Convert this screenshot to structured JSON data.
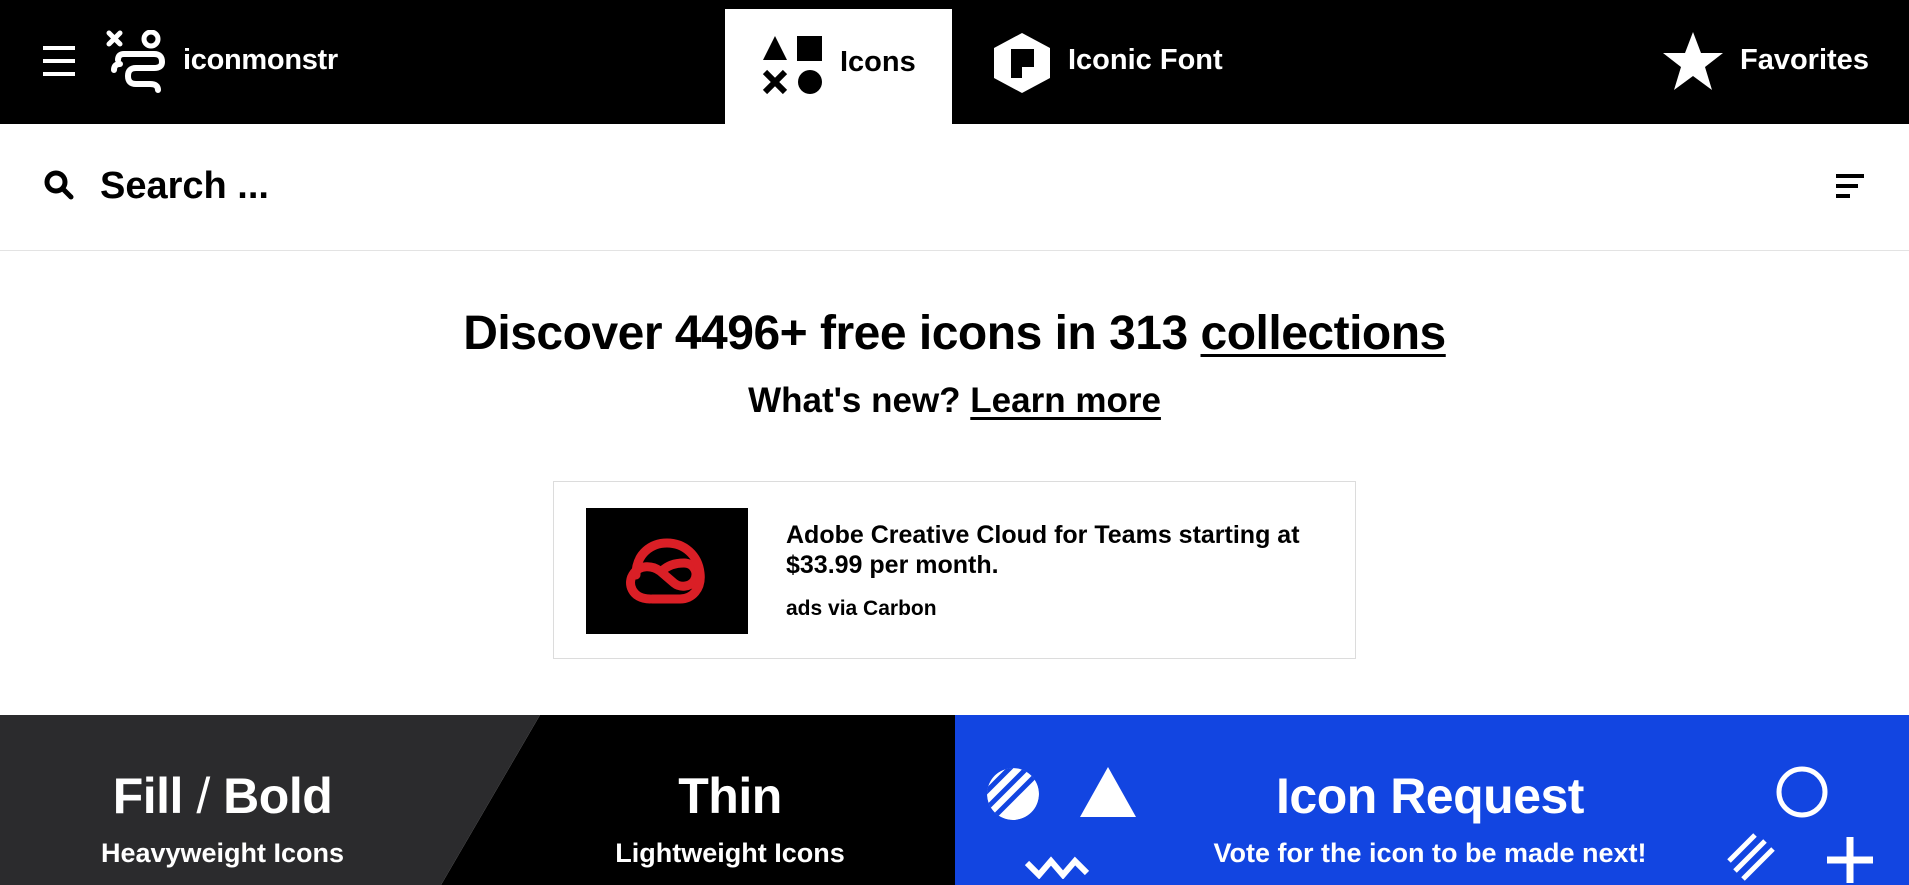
{
  "header": {
    "logo_text": "iconmonstr",
    "tabs": [
      {
        "label": "Icons",
        "icon": "shapes-icon",
        "active": true
      },
      {
        "label": "Iconic Font",
        "icon": "iconic-font-icon",
        "active": false
      },
      {
        "label": "Favorites",
        "icon": "star-icon",
        "active": false
      }
    ]
  },
  "search": {
    "placeholder": "Search ..."
  },
  "hero": {
    "headline_prefix": "Discover 4496+ free icons in 313 ",
    "headline_link": "collections",
    "sub_prefix": "What's new? ",
    "sub_link": "Learn more"
  },
  "ad": {
    "text": "Adobe Creative Cloud for Teams starting at $33.99 per month.",
    "via": "ads via Carbon",
    "logo_color": "#da1f26"
  },
  "banners": {
    "fill": {
      "title_a": "Fill",
      "title_sep": "/",
      "title_b": "Bold",
      "subtitle": "Heavyweight Icons"
    },
    "thin": {
      "title": "Thin",
      "subtitle": "Lightweight Icons"
    },
    "request": {
      "title": "Icon Request",
      "subtitle": "Vote for the icon to be made next!",
      "color": "#1245e1"
    }
  }
}
